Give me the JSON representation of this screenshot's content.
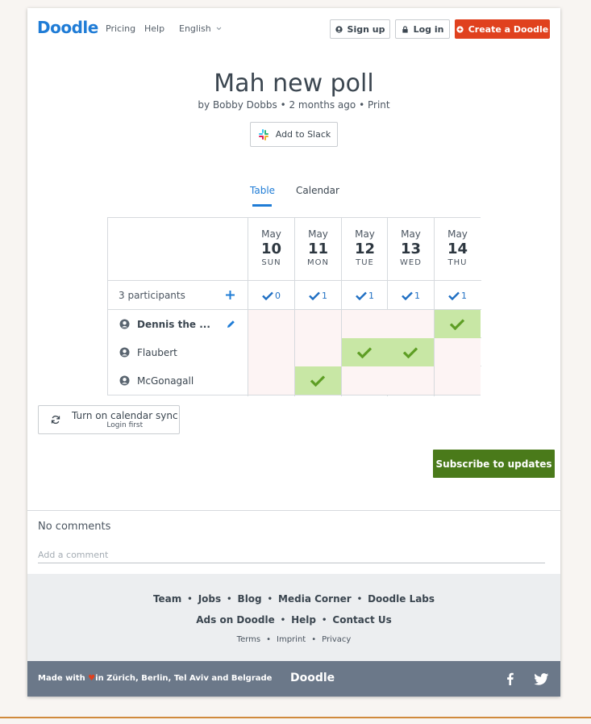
{
  "header": {
    "logo": "Doodle",
    "nav": {
      "pricing": "Pricing",
      "help": "Help",
      "language": "English"
    },
    "signup": "Sign up",
    "login": "Log in",
    "create": "Create a Doodle"
  },
  "poll": {
    "title": "Mah new poll",
    "author": "by Bobby Dobbs",
    "sep1": "•",
    "time_ago": "2 months ago",
    "sep2": "•",
    "print": "Print",
    "slack": "Add to Slack"
  },
  "tabs": {
    "table": "Table",
    "calendar": "Calendar"
  },
  "table": {
    "participants_label": "3 participants",
    "dates": [
      {
        "month": "May",
        "day": "10",
        "dow": "SUN",
        "count": "0"
      },
      {
        "month": "May",
        "day": "11",
        "dow": "MON",
        "count": "1"
      },
      {
        "month": "May",
        "day": "12",
        "dow": "TUE",
        "count": "1"
      },
      {
        "month": "May",
        "day": "13",
        "dow": "WED",
        "count": "1"
      },
      {
        "month": "May",
        "day": "14",
        "dow": "THU",
        "count": "1"
      }
    ],
    "participants": [
      {
        "name": "Dennis the ...",
        "editable": true,
        "votes": [
          false,
          false,
          false,
          false,
          true
        ]
      },
      {
        "name": "Flaubert",
        "editable": false,
        "votes": [
          false,
          false,
          true,
          true,
          false
        ]
      },
      {
        "name": "McGonagall",
        "editable": false,
        "votes": [
          false,
          true,
          false,
          false,
          false
        ]
      }
    ]
  },
  "sync": {
    "main": "Turn on calendar sync",
    "sub": "Login first"
  },
  "subscribe": "Subscribe to updates",
  "comments": {
    "title": "No comments",
    "placeholder": "Add a comment"
  },
  "footer": {
    "row1": [
      "Team",
      "Jobs",
      "Blog",
      "Media Corner",
      "Doodle Labs"
    ],
    "row2": [
      "Ads on Doodle",
      "Help",
      "Contact Us"
    ],
    "row3": [
      "Terms",
      "Imprint",
      "Privacy"
    ],
    "separator": "•",
    "made_with_pre": "Made with",
    "made_with_post": "in Zürich, Berlin, Tel Aviv and Belgrade",
    "logo": "Doodle"
  },
  "colors": {
    "brand_blue": "#1f7cd6",
    "create_red": "#e0411e",
    "yes_green": "#c8e7a5",
    "check_green": "#5e9e25",
    "subscribe_green": "#4a7a1a"
  },
  "icons": [
    "user-icon",
    "lock-icon",
    "plus-circle-icon",
    "slack-icon",
    "plus-icon",
    "check-icon",
    "pencil-icon",
    "sync-icon",
    "heart-icon",
    "facebook-icon",
    "twitter-icon",
    "chevron-down-icon"
  ]
}
